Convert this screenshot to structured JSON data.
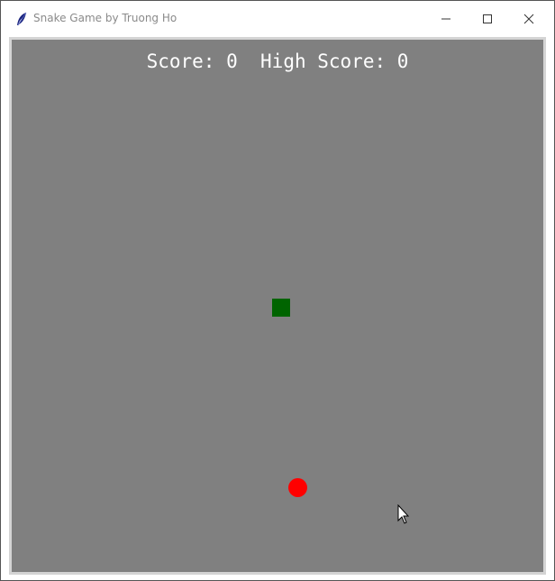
{
  "window": {
    "title": "Snake Game by Truong Ho",
    "icon": "feather-icon",
    "controls": [
      "minimize-icon",
      "maximize-icon",
      "close-icon"
    ]
  },
  "game": {
    "score_label": "Score:",
    "score": 0,
    "high_score_label": "High Score:",
    "high_score": 0,
    "background_color": "#808080",
    "snake_color": "#006400",
    "food_color": "#ff0000",
    "snake_length": 1
  }
}
